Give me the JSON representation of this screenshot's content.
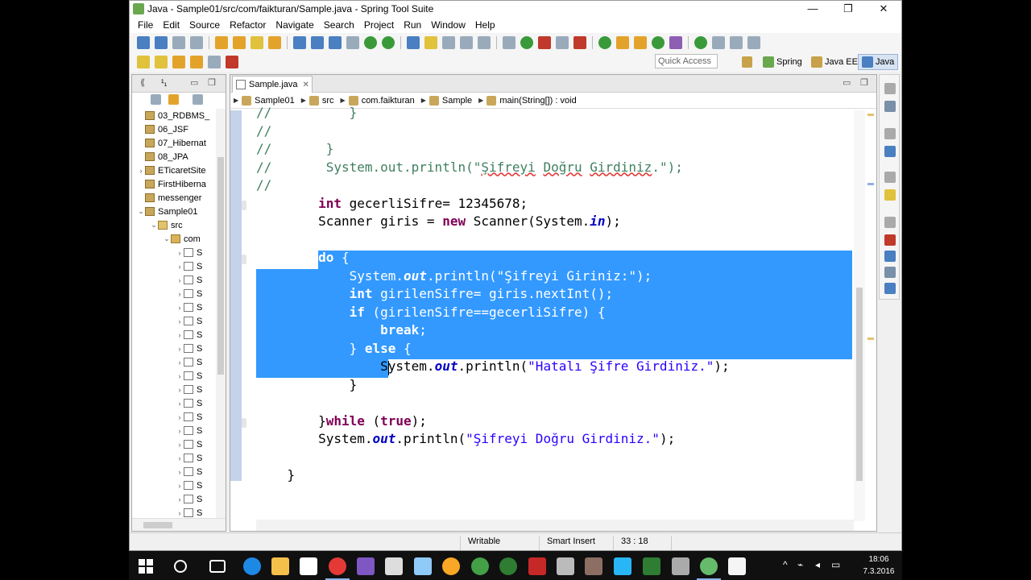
{
  "window": {
    "title": "Java - Sample01/src/com/faikturan/Sample.java - Spring Tool Suite",
    "controls": [
      "—",
      "❐",
      "✕"
    ]
  },
  "menu": [
    "File",
    "Edit",
    "Source",
    "Refactor",
    "Navigate",
    "Search",
    "Project",
    "Run",
    "Window",
    "Help"
  ],
  "toolbar": {
    "quick_access_placeholder": "Quick Access",
    "perspectives": [
      "Spring",
      "Java EE",
      "Java"
    ]
  },
  "explorer": {
    "tab_label": "¹₁",
    "items": [
      {
        "label": "03_RDBMS_",
        "type": "proj",
        "indent": 0,
        "twisty": ""
      },
      {
        "label": "06_JSF",
        "type": "proj",
        "indent": 0,
        "twisty": ""
      },
      {
        "label": "07_Hibernat",
        "type": "proj",
        "indent": 0,
        "twisty": ""
      },
      {
        "label": "08_JPA",
        "type": "proj",
        "indent": 0,
        "twisty": ""
      },
      {
        "label": "ETicaretSite",
        "type": "proj",
        "indent": 0,
        "twisty": "›"
      },
      {
        "label": "FirstHiberna",
        "type": "proj",
        "indent": 0,
        "twisty": ""
      },
      {
        "label": "messenger",
        "type": "proj",
        "indent": 0,
        "twisty": ""
      },
      {
        "label": "Sample01",
        "type": "proj",
        "indent": 0,
        "twisty": "⌄"
      },
      {
        "label": "src",
        "type": "src",
        "indent": 1,
        "twisty": "⌄"
      },
      {
        "label": "com",
        "type": "pkg",
        "indent": 2,
        "twisty": "⌄"
      },
      {
        "label": "S",
        "type": "java",
        "indent": 3,
        "twisty": "›"
      },
      {
        "label": "S",
        "type": "java",
        "indent": 3,
        "twisty": "›"
      },
      {
        "label": "S",
        "type": "java",
        "indent": 3,
        "twisty": "›"
      },
      {
        "label": "S",
        "type": "java",
        "indent": 3,
        "twisty": "›"
      },
      {
        "label": "S",
        "type": "java",
        "indent": 3,
        "twisty": "›"
      },
      {
        "label": "S",
        "type": "java",
        "indent": 3,
        "twisty": "›"
      },
      {
        "label": "S",
        "type": "java",
        "indent": 3,
        "twisty": "›"
      },
      {
        "label": "S",
        "type": "java",
        "indent": 3,
        "twisty": "›"
      },
      {
        "label": "S",
        "type": "java",
        "indent": 3,
        "twisty": "›"
      },
      {
        "label": "S",
        "type": "java",
        "indent": 3,
        "twisty": "›"
      },
      {
        "label": "S",
        "type": "java",
        "indent": 3,
        "twisty": "›"
      },
      {
        "label": "S",
        "type": "java",
        "indent": 3,
        "twisty": "›"
      },
      {
        "label": "S",
        "type": "java",
        "indent": 3,
        "twisty": "›"
      },
      {
        "label": "S",
        "type": "java",
        "indent": 3,
        "twisty": "›"
      },
      {
        "label": "S",
        "type": "java",
        "indent": 3,
        "twisty": "›"
      },
      {
        "label": "S",
        "type": "java",
        "indent": 3,
        "twisty": "›"
      },
      {
        "label": "S",
        "type": "java",
        "indent": 3,
        "twisty": "›"
      },
      {
        "label": "S",
        "type": "java",
        "indent": 3,
        "twisty": "›"
      },
      {
        "label": "S",
        "type": "java",
        "indent": 3,
        "twisty": "›"
      },
      {
        "label": "S",
        "type": "java",
        "indent": 3,
        "twisty": "›"
      }
    ]
  },
  "editor": {
    "tab_label": "Sample.java",
    "breadcrumb": [
      "Sample01",
      "src",
      "com.faikturan",
      "Sample",
      "main(String[]) : void"
    ],
    "code": [
      {
        "s": [
          {
            "t": "//",
            "c": "cm"
          },
          {
            "t": "          }",
            "c": "cm"
          }
        ]
      },
      {
        "s": [
          {
            "t": "//",
            "c": "cm"
          }
        ]
      },
      {
        "s": [
          {
            "t": "//       }",
            "c": "cm"
          }
        ]
      },
      {
        "s": [
          {
            "t": "//       System.out.println(\"",
            "c": "cm"
          },
          {
            "t": "Şifreyi",
            "c": "cm sq"
          },
          {
            "t": " ",
            "c": "cm"
          },
          {
            "t": "Doğru",
            "c": "cm sq"
          },
          {
            "t": " ",
            "c": "cm"
          },
          {
            "t": "Girdiniz",
            "c": "cm sq"
          },
          {
            "t": ".\");",
            "c": "cm"
          }
        ]
      },
      {
        "s": [
          {
            "t": "//",
            "c": "cm"
          }
        ]
      },
      {
        "s": [
          {
            "t": "        "
          },
          {
            "t": "int",
            "c": "kw"
          },
          {
            "t": " gecerliSifre= 12345678;"
          }
        ]
      },
      {
        "s": [
          {
            "t": "        Scanner giris = "
          },
          {
            "t": "new",
            "c": "kw"
          },
          {
            "t": " Scanner(System."
          },
          {
            "t": "in",
            "c": "fld"
          },
          {
            "t": ");"
          }
        ]
      },
      {
        "s": [
          {
            "t": ""
          }
        ]
      },
      {
        "s": [
          {
            "t": "        "
          },
          {
            "t": "do",
            "c": "kw"
          },
          {
            "t": " {"
          }
        ],
        "sel": true
      },
      {
        "s": [
          {
            "t": "            System."
          },
          {
            "t": "out",
            "c": "fld"
          },
          {
            "t": ".println("
          },
          {
            "t": "\"Şifreyi Giriniz:\"",
            "c": "str"
          },
          {
            "t": ");"
          }
        ],
        "sel": true
      },
      {
        "s": [
          {
            "t": "            "
          },
          {
            "t": "int",
            "c": "kw"
          },
          {
            "t": " girilenSifre= giris.nextInt();"
          }
        ],
        "sel": true
      },
      {
        "s": [
          {
            "t": "            "
          },
          {
            "t": "if",
            "c": "kw"
          },
          {
            "t": " (girilenSifre==gecerliSifre) {"
          }
        ],
        "sel": true
      },
      {
        "s": [
          {
            "t": "                "
          },
          {
            "t": "break",
            "c": "kw"
          },
          {
            "t": ";"
          }
        ],
        "sel": true
      },
      {
        "s": [
          {
            "t": "            } "
          },
          {
            "t": "else",
            "c": "kw"
          },
          {
            "t": " {"
          }
        ],
        "sel": true
      },
      {
        "s": [
          {
            "t": "                System."
          },
          {
            "t": "out",
            "c": "fld"
          },
          {
            "t": ".println("
          },
          {
            "t": "\"Hatalı Şifre Girdiniz.\"",
            "c": "str"
          },
          {
            "t": ");"
          }
        ]
      },
      {
        "s": [
          {
            "t": "            }"
          }
        ]
      },
      {
        "s": [
          {
            "t": ""
          }
        ]
      },
      {
        "s": [
          {
            "t": "        }"
          },
          {
            "t": "while",
            "c": "kw"
          },
          {
            "t": " ("
          },
          {
            "t": "true",
            "c": "kw"
          },
          {
            "t": ");"
          }
        ]
      },
      {
        "s": [
          {
            "t": "        System."
          },
          {
            "t": "out",
            "c": "fld"
          },
          {
            "t": ".println("
          },
          {
            "t": "\"Şifreyi Doğru Girdiniz.\"",
            "c": "str"
          },
          {
            "t": ");"
          }
        ]
      },
      {
        "s": [
          {
            "t": ""
          }
        ]
      },
      {
        "s": [
          {
            "t": "    }"
          }
        ]
      }
    ]
  },
  "status": {
    "writable": "Writable",
    "insert_mode": "Smart Insert",
    "position": "33 : 18"
  },
  "taskbar": {
    "time": "18:06",
    "date": "7.3.2016"
  },
  "colors": {
    "selection": "#3399ff",
    "keyword": "#7f0055",
    "string": "#2a00ff",
    "comment": "#3f7f5f"
  }
}
